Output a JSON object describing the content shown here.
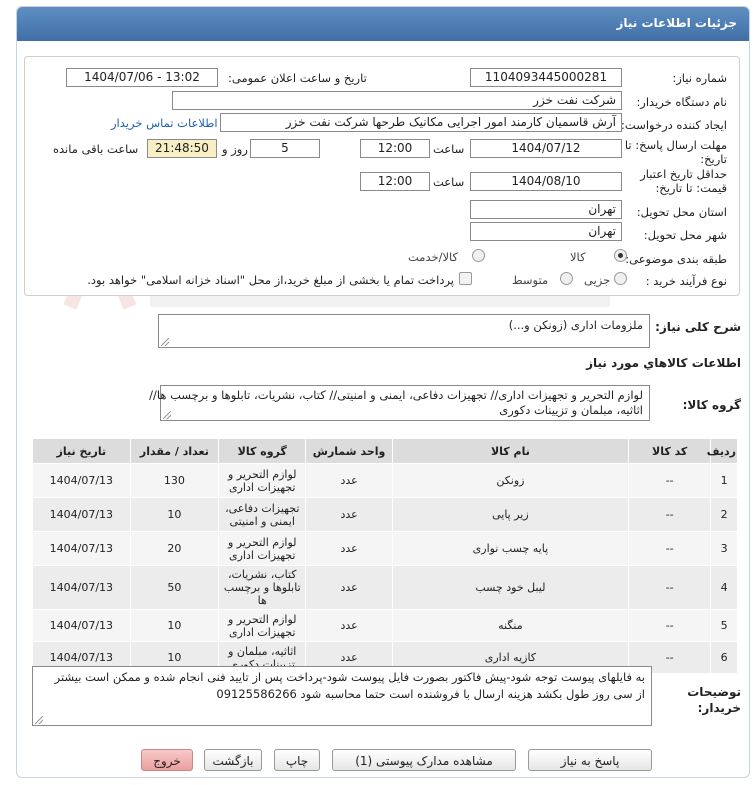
{
  "header": {
    "title": "جزئیات اطلاعات نیاز"
  },
  "form": {
    "need_number_label": "شماره نیاز:",
    "need_number": "1104093445000281",
    "announce_label": "تاریخ و ساعت اعلان عمومی:",
    "announce_value": "1404/07/06 - 13:02",
    "buyer_label": "نام دستگاه خریدار:",
    "buyer_value": "شرکت نفت خزر",
    "creator_label": "ایجاد کننده درخواست:",
    "creator_value": "آرش قاسمیان کارمند امور اجرایی مکانیک طرحها شرکت نفت خزر",
    "contact_link": "اطلاعات تماس خریدار",
    "deadline_label_1": "مهلت ارسال پاسخ: تا",
    "deadline_label_2": "تاریخ:",
    "deadline_date": "1404/07/12",
    "time_label": "ساعت",
    "deadline_time": "12:00",
    "days_value": "5",
    "days_label": "روز و",
    "remaining_value": "21:48:50",
    "remaining_label": "ساعت باقی مانده",
    "validity_label_1": "حداقل تاریخ اعتبار",
    "validity_label_2": "قیمت: تا تاریخ:",
    "validity_date": "1404/08/10",
    "validity_time": "12:00",
    "province_label": "استان محل تحویل:",
    "province_value": "تهران",
    "city_label": "شهر محل تحویل:",
    "city_value": "تهران",
    "category_label": "طبقه بندی موضوعی:",
    "category_options": [
      "کالا",
      "کالا/خدمت"
    ],
    "process_label": "نوع فرآیند خرید :",
    "process_options": [
      "جزیی",
      "متوسط"
    ],
    "payment_note": "پرداخت تمام یا بخشی از مبلغ خرید،از محل \"اسناد خزانه اسلامی\" خواهد بود."
  },
  "summary": {
    "label": "شرح کلی نیاز:",
    "value": "ملزومات اداری (زونکن و...)"
  },
  "goods_info_title": "اطلاعات کالاهاي مورد نياز",
  "goods_group": {
    "label": "گروه کالا:",
    "line1": "لوازم التحریر و تجهیزات اداری// تجهیزات دفاعی، ایمنی و امنیتی// کتاب، نشریات، تابلوها و برچسب ها//",
    "line2": "اثاثیه، مبلمان و تزیینات دکوری"
  },
  "table": {
    "headers": [
      "ردیف",
      "کد کالا",
      "نام کالا",
      "واحد شمارش",
      "گروه کالا",
      "تعداد / مقدار",
      "تاریخ نیاز"
    ],
    "rows": [
      [
        "1",
        "--",
        "زونکن",
        "عدد",
        "لوازم التحریر و تجهیزات اداری",
        "130",
        "1404/07/13"
      ],
      [
        "2",
        "--",
        "زیر پایی",
        "عدد",
        "تجهیزات دفاعی، ایمنی و امنیتی",
        "10",
        "1404/07/13"
      ],
      [
        "3",
        "--",
        "پایه چسب نواری",
        "عدد",
        "لوازم التحریر و تجهیزات اداری",
        "20",
        "1404/07/13"
      ],
      [
        "4",
        "--",
        "لیبل خود چسب",
        "عدد",
        "کتاب، نشریات، تابلوها و برچسب ها",
        "50",
        "1404/07/13"
      ],
      [
        "5",
        "--",
        "منگنه",
        "عدد",
        "لوازم التحریر و تجهیزات اداری",
        "10",
        "1404/07/13"
      ],
      [
        "6",
        "--",
        "کازیه اداری",
        "عدد",
        "اثاثیه، مبلمان و تزیینات دکوری",
        "10",
        "1404/07/13"
      ]
    ]
  },
  "buyer_notes": {
    "label_1": "توضیحات",
    "label_2": "خریدار:",
    "line1": "به فایلهای پیوست توجه شود-پیش فاکتور بصورت فایل پیوست شود-پرداخت پس از تایید فنی انجام شده و ممکن است بیشتر",
    "line2": "از سی روز طول بکشد هزینه ارسال با فروشنده است حتما محاسبه شود 09125586266"
  },
  "buttons": {
    "reply": "پاسخ به نیاز",
    "attachments": "مشاهده مدارک پیوستی (1)",
    "print": "چاپ",
    "back": "بازگشت",
    "exit": "خروج"
  },
  "colors": {
    "header": "#4a7db4",
    "remaining_bg": "#f8efc4",
    "exit_button": "#ec9f9f",
    "link": "#1f5fb0"
  }
}
